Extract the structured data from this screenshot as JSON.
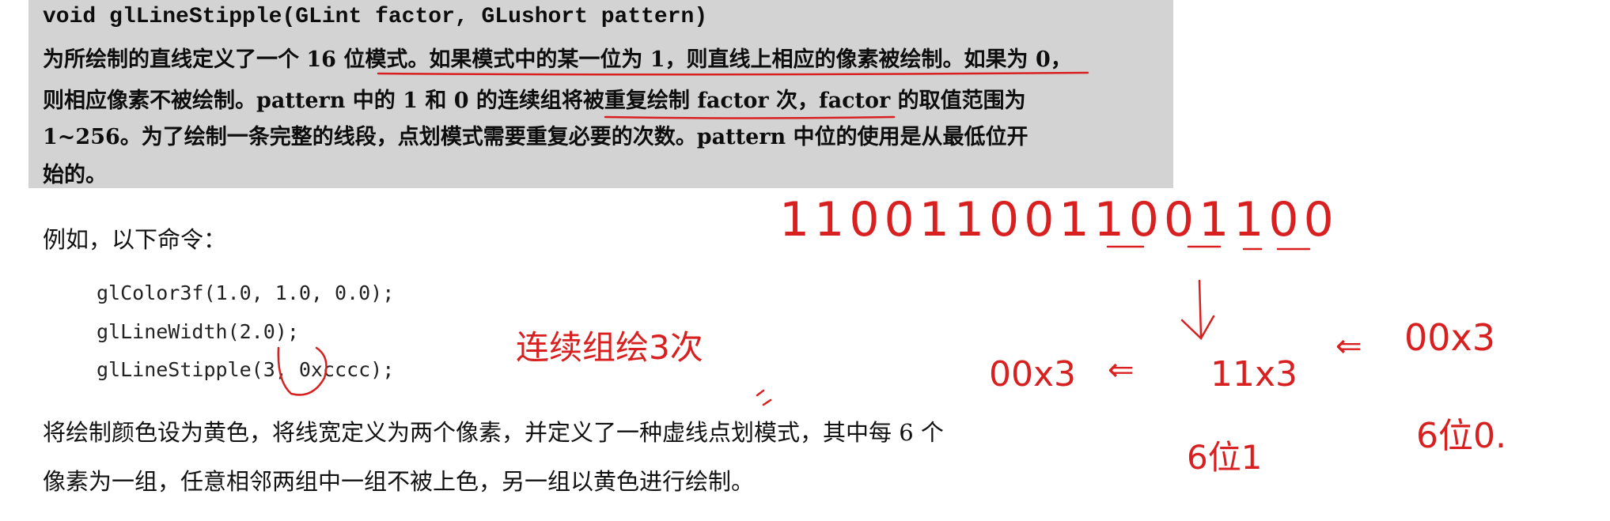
{
  "boxed_text": {
    "signature": "void glLineStipple(GLint factor, GLushort pattern)",
    "line1": "为所绘制的直线定义了一个 16 位模式。如果模式中的某一位为 1，则直线上相应的像素被绘制。如果为 0，",
    "line2": "则相应像素不被绘制。pattern 中的 1 和 0 的连续组将被重复绘制 factor 次，factor 的取值范围为",
    "line3": "1~256。为了绘制一条完整的线段，点划模式需要重复必要的次数。pattern 中位的使用是从最低位开",
    "line4": "始的。"
  },
  "example_intro": "例如，以下命令：",
  "code": {
    "line1": "glColor3f(1.0, 1.0, 0.0);",
    "line2": "glLineWidth(2.0);",
    "line3": "glLineStipple(3, 0xcccc);"
  },
  "description": {
    "line1": "将绘制颜色设为黄色，将线宽定义为两个像素，并定义了一种虚线点划模式，其中每 6 个",
    "line2": "像素为一组，任意相邻两组中一组不被上色，另一组以黄色进行绘制。"
  },
  "annotations": {
    "bits": "1100110011001100",
    "repeat_note": "连续组绘3次",
    "zeros_x3_left": "00x3",
    "arrow_left": "⇐",
    "ones_x3": "11x3",
    "arrow_right": "⇐",
    "zeros_x3_right": "00x3",
    "six_ones": "6位1",
    "six_zeros": "6位0."
  },
  "colors": {
    "box_background": "#d3d3d3",
    "annotation_ink": "#d92020"
  }
}
